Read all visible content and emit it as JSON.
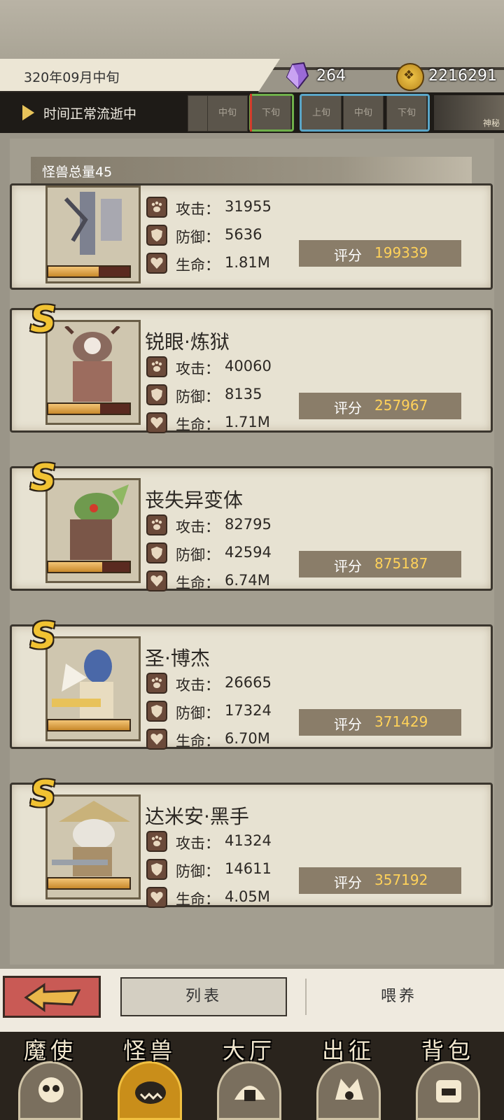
{
  "header": {
    "date": "320年09月中旬",
    "crystals": "264",
    "gold": "2216291"
  },
  "timebar": {
    "status": "时间正常流逝中",
    "slots": [
      "中旬",
      "下旬",
      "上旬",
      "中旬",
      "下旬"
    ],
    "mystery_label": "神秘"
  },
  "list": {
    "total": "怪兽总量45",
    "stat_labels": {
      "attack": "攻击：",
      "defense": "防御：",
      "hp": "生命："
    },
    "score_label": "评分",
    "monsters": [
      {
        "name": "",
        "attack": "31955",
        "defense": "5636",
        "hp": "1.81M",
        "score": "199339",
        "bar": 0.62
      },
      {
        "name": "锐眼·炼狱",
        "rank": "S",
        "attack": "40060",
        "defense": "8135",
        "hp": "1.71M",
        "score": "257967",
        "bar": 0.64
      },
      {
        "name": "丧失异变体",
        "rank": "S",
        "attack": "82795",
        "defense": "42594",
        "hp": "6.74M",
        "score": "875187",
        "bar": 0.66
      },
      {
        "name": "圣·博杰",
        "rank": "S",
        "attack": "26665",
        "defense": "17324",
        "hp": "6.70M",
        "score": "371429",
        "bar": 1.0
      },
      {
        "name": "达米安·黑手",
        "rank": "S",
        "attack": "41324",
        "defense": "14611",
        "hp": "4.05M",
        "score": "357192",
        "bar": 1.0
      }
    ]
  },
  "bottom": {
    "tab_list": "列表",
    "tab_feed": "喂养"
  },
  "nav": [
    {
      "label": "魔使",
      "icon": "skull-icon"
    },
    {
      "label": "怪兽",
      "icon": "monster-icon",
      "active": true
    },
    {
      "label": "大厅",
      "icon": "hall-icon"
    },
    {
      "label": "出征",
      "icon": "expedition-icon"
    },
    {
      "label": "背包",
      "icon": "backpack-icon"
    }
  ]
}
